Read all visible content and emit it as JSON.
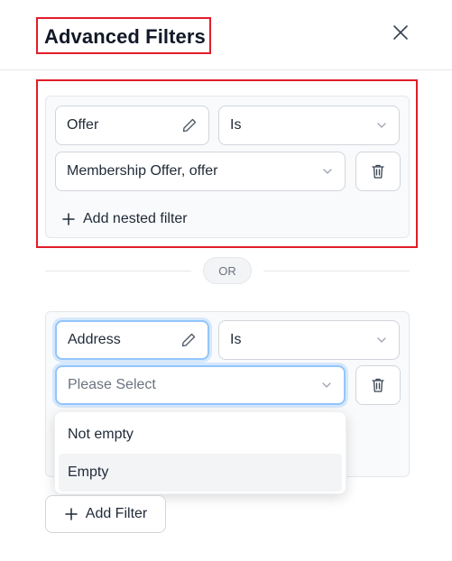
{
  "header": {
    "title": "Advanced Filters",
    "close_icon": "close-icon"
  },
  "filter_groups": [
    {
      "field_label": "Offer",
      "operator": "Is",
      "value": "Membership Offer, offer",
      "add_nested_label": "Add nested filter"
    },
    {
      "field_label": "Address",
      "operator": "Is",
      "value_placeholder": "Please Select",
      "dropdown_options": [
        "Not empty",
        "Empty"
      ]
    }
  ],
  "separator": {
    "label": "OR"
  },
  "footer": {
    "add_filter_label": "Add Filter"
  },
  "colors": {
    "highlight": "#e11d2a",
    "focus_ring": "#93c5fd"
  }
}
